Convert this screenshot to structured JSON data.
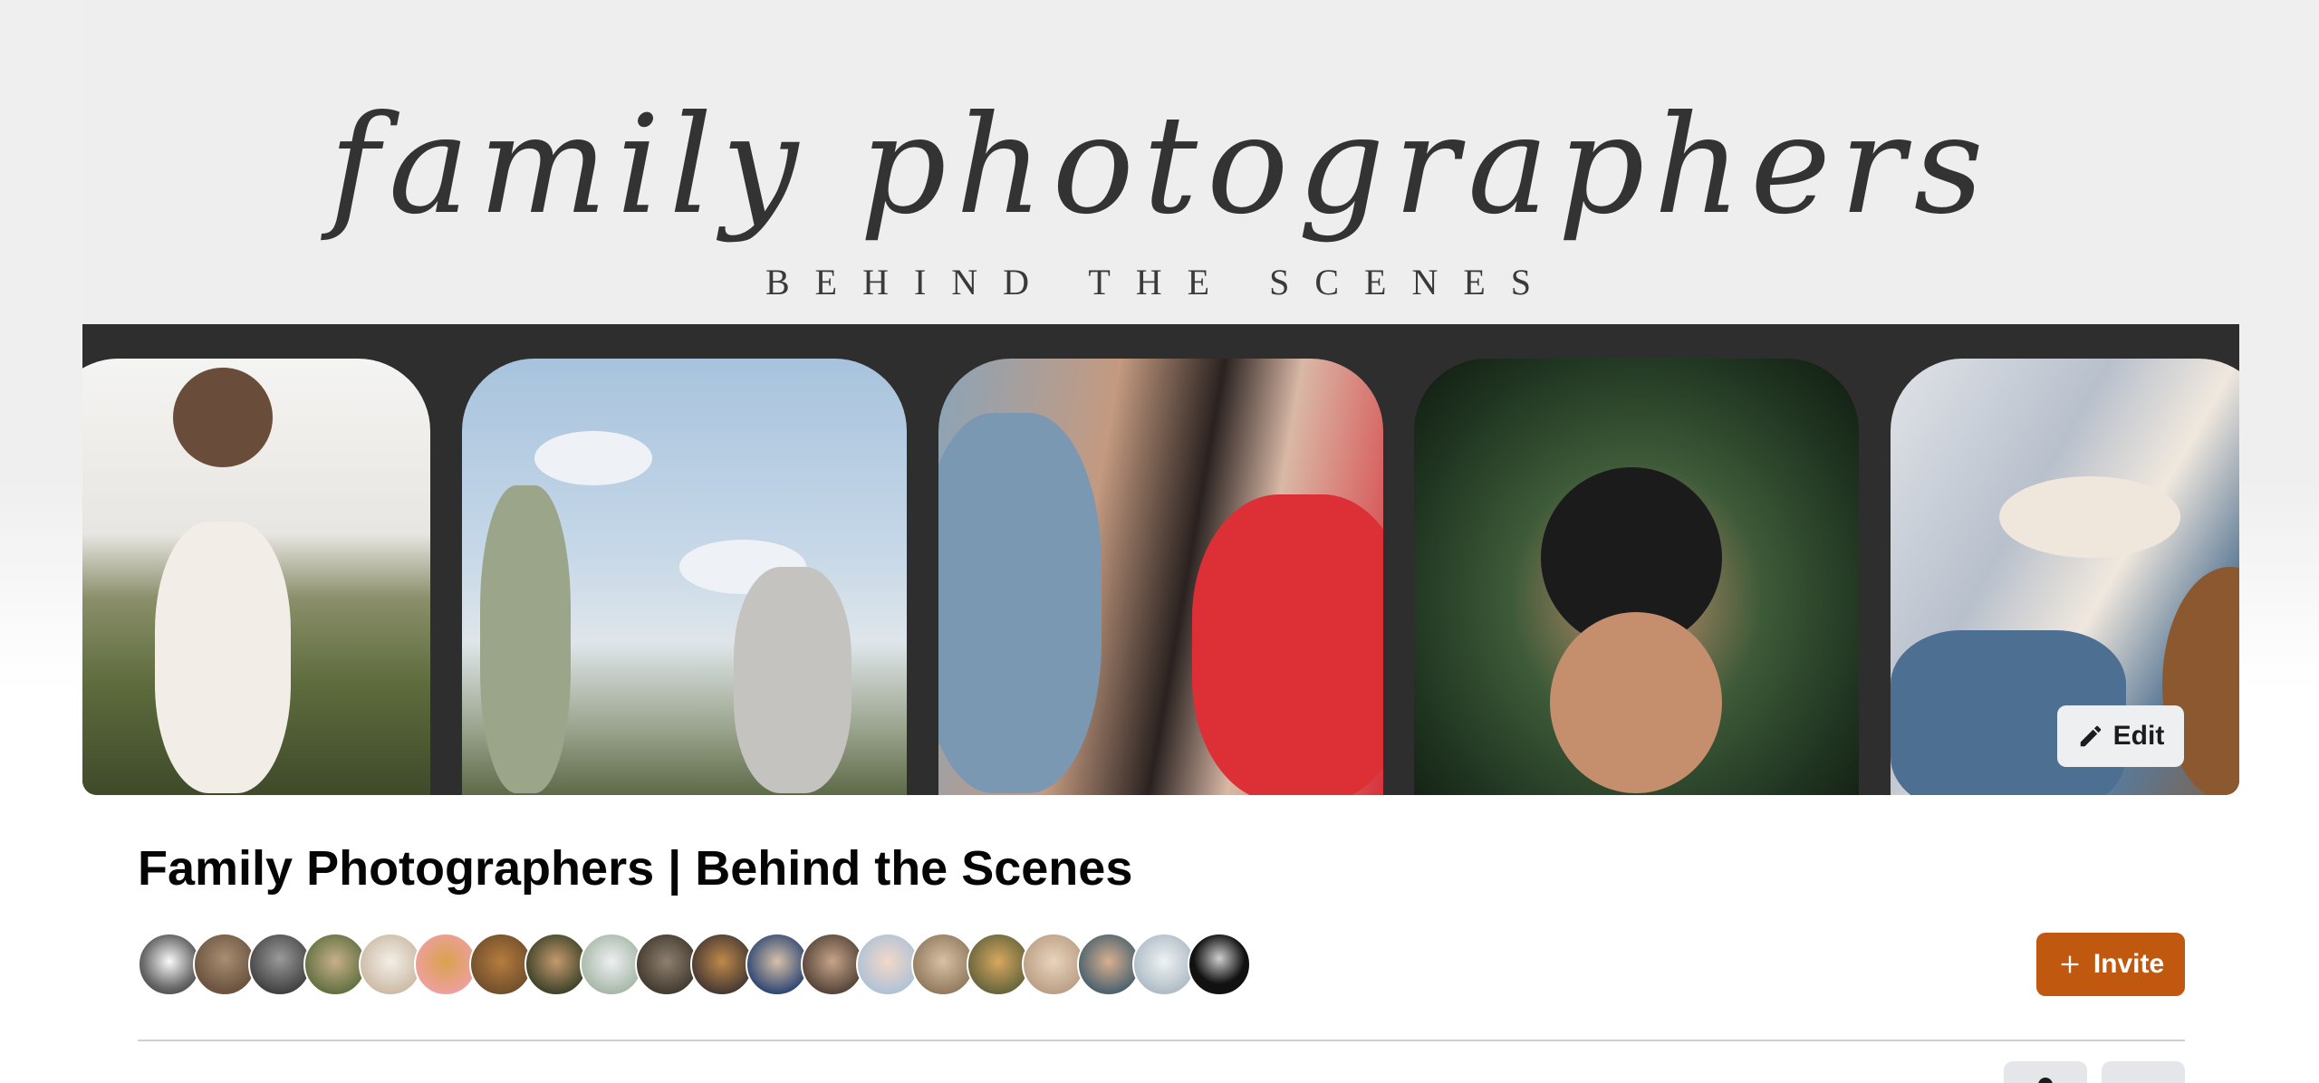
{
  "cover": {
    "script_title": "family photographers",
    "subtitle": "BEHIND THE SCENES",
    "edit_label": "Edit",
    "photos": [
      {
        "name": "father-son-photo"
      },
      {
        "name": "mother-children-sky-photo"
      },
      {
        "name": "couple-kiss-photo"
      },
      {
        "name": "maternity-photo"
      },
      {
        "name": "newborn-dog-photo"
      }
    ]
  },
  "group": {
    "title": "Family Photographers | Behind the Scenes",
    "invite_label": "Invite",
    "member_avatar_count": 20
  },
  "colors": {
    "accent": "#c0580f",
    "strip": "#2e2e2e",
    "cover_bg": "#eeeeee"
  },
  "icons": {
    "edit": "pencil-icon",
    "invite": "plus-icon"
  }
}
